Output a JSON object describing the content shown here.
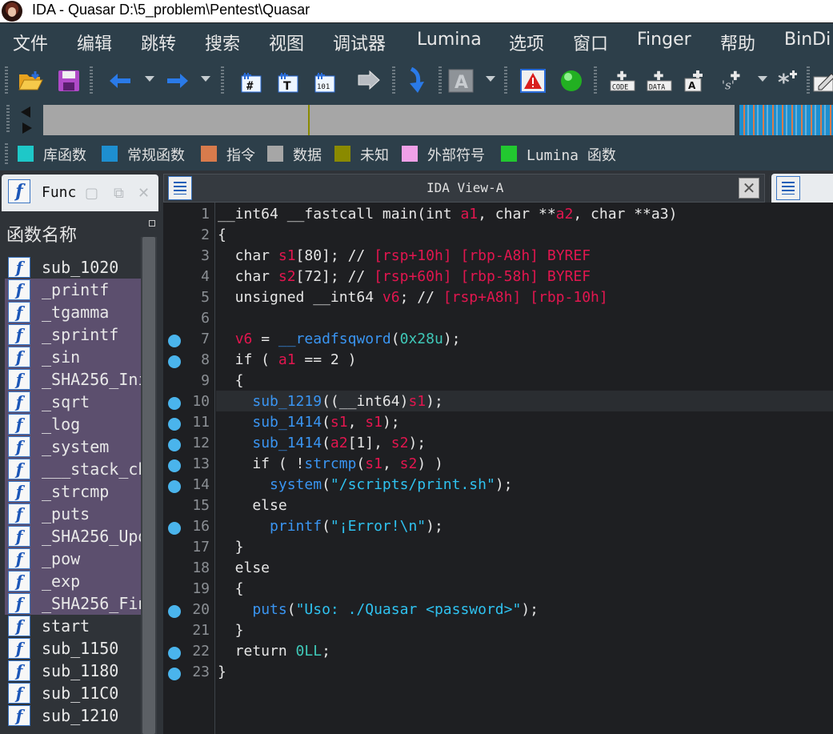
{
  "titlebar": {
    "title": "IDA - Quasar D:\\5_problem\\Pentest\\Quasar"
  },
  "menubar": {
    "items": [
      "文件",
      "编辑",
      "跳转",
      "搜索",
      "视图",
      "调试器",
      "Lumina",
      "选项",
      "窗口",
      "Finger",
      "帮助",
      "BinDi"
    ]
  },
  "toolbar": {
    "icons": [
      "open-folder-icon",
      "save-disk-icon",
      "back-arrow-icon",
      "forward-arrow-icon",
      "hex-view-icon",
      "text-view-icon",
      "binary-view-icon",
      "jump-icon",
      "step-into-icon",
      "font-icon",
      "warning-icon",
      "green-circle-icon",
      "code-icon",
      "data-icon",
      "ascii-icon",
      "struct-icon",
      "asterisk-icon",
      "edit-icon"
    ]
  },
  "legend": {
    "items": [
      {
        "label": "库函数",
        "color": "#1ec8c8"
      },
      {
        "label": "常规函数",
        "color": "#1e8fd0"
      },
      {
        "label": "指令",
        "color": "#d87b4c"
      },
      {
        "label": "数据",
        "color": "#a6a6a6"
      },
      {
        "label": "未知",
        "color": "#8a8a00"
      },
      {
        "label": "外部符号",
        "color": "#f0a0e8"
      },
      {
        "label": "Lumina 函数",
        "color": "#22c830"
      }
    ]
  },
  "functions_panel": {
    "tab_label": "Func",
    "header": "函数名称",
    "items": [
      {
        "name": "sub_1020",
        "highlight": false
      },
      {
        "name": "_printf",
        "highlight": true
      },
      {
        "name": "_tgamma",
        "highlight": true
      },
      {
        "name": "_sprintf",
        "highlight": true
      },
      {
        "name": "_sin",
        "highlight": true
      },
      {
        "name": "_SHA256_Ini",
        "highlight": true
      },
      {
        "name": "_sqrt",
        "highlight": true
      },
      {
        "name": "_log",
        "highlight": true
      },
      {
        "name": "_system",
        "highlight": true
      },
      {
        "name": "___stack_ch",
        "highlight": true
      },
      {
        "name": "_strcmp",
        "highlight": true
      },
      {
        "name": "_puts",
        "highlight": true
      },
      {
        "name": "_SHA256_Upd",
        "highlight": true
      },
      {
        "name": "_pow",
        "highlight": true
      },
      {
        "name": "_exp",
        "highlight": true
      },
      {
        "name": "_SHA256_Fin",
        "highlight": true
      },
      {
        "name": "start",
        "highlight": false
      },
      {
        "name": "sub_1150",
        "highlight": false
      },
      {
        "name": "sub_1180",
        "highlight": false
      },
      {
        "name": "sub_11C0",
        "highlight": false
      },
      {
        "name": "sub_1210",
        "highlight": false
      }
    ]
  },
  "ida_view": {
    "title": "IDA View-A",
    "lines": [
      {
        "n": "1",
        "bp": false,
        "t": "__int64 __fastcall main(int a1, char **a2, char **a3)"
      },
      {
        "n": "2",
        "bp": false,
        "t": "{"
      },
      {
        "n": "3",
        "bp": false,
        "t": "  char s1[80]; // [rsp+10h] [rbp-A8h] BYREF"
      },
      {
        "n": "4",
        "bp": false,
        "t": "  char s2[72]; // [rsp+60h] [rbp-58h] BYREF"
      },
      {
        "n": "5",
        "bp": false,
        "t": "  unsigned __int64 v6; // [rsp+A8h] [rbp-10h]"
      },
      {
        "n": "6",
        "bp": false,
        "t": ""
      },
      {
        "n": "7",
        "bp": true,
        "t": "  v6 = __readfsqword(0x28u);"
      },
      {
        "n": "8",
        "bp": true,
        "t": "  if ( a1 == 2 )"
      },
      {
        "n": "9",
        "bp": false,
        "t": "  {"
      },
      {
        "n": "10",
        "bp": true,
        "t": "    sub_1219((__int64)s1);"
      },
      {
        "n": "11",
        "bp": true,
        "t": "    sub_1414(s1, s1);"
      },
      {
        "n": "12",
        "bp": true,
        "t": "    sub_1414(a2[1], s2);"
      },
      {
        "n": "13",
        "bp": true,
        "t": "    if ( !strcmp(s1, s2) )"
      },
      {
        "n": "14",
        "bp": true,
        "t": "      system(\"/scripts/print.sh\");"
      },
      {
        "n": "15",
        "bp": false,
        "t": "    else"
      },
      {
        "n": "16",
        "bp": true,
        "t": "      printf(\"¡Error!\\n\");"
      },
      {
        "n": "17",
        "bp": false,
        "t": "  }"
      },
      {
        "n": "18",
        "bp": false,
        "t": "  else"
      },
      {
        "n": "19",
        "bp": false,
        "t": "  {"
      },
      {
        "n": "20",
        "bp": true,
        "t": "    puts(\"Uso: ./Quasar <password>\");"
      },
      {
        "n": "21",
        "bp": false,
        "t": "  }"
      },
      {
        "n": "22",
        "bp": true,
        "t": "  return 0LL;"
      },
      {
        "n": "23",
        "bp": true,
        "t": "}"
      }
    ]
  }
}
